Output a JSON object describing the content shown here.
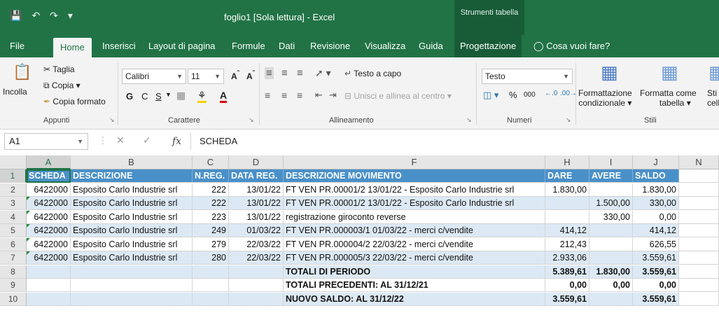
{
  "titlebar": {
    "title": "foglio1  [Sola lettura]  -  Excel",
    "tool_context": "Strumenti tabella"
  },
  "tabs": [
    "File",
    "Home",
    "Inserisci",
    "Layout di pagina",
    "Formule",
    "Dati",
    "Revisione",
    "Visualizza",
    "Guida",
    "Progettazione"
  ],
  "tell_me": "Cosa vuoi fare?",
  "ribbon": {
    "appunti": {
      "incolla": "Incolla",
      "taglia": "Taglia",
      "copia": "Copia",
      "copia_formato": "Copia formato",
      "label": "Appunti"
    },
    "carattere": {
      "font": "Calibri",
      "size": "11",
      "bold": "G",
      "italic": "C",
      "underline": "S",
      "label": "Carattere"
    },
    "allineamento": {
      "testo_a_capo": "Testo a capo",
      "unisci": "Unisci e allinea al centro",
      "label": "Allineamento"
    },
    "numeri": {
      "format": "Testo",
      "percent": "%",
      "thousands": "000",
      "label": "Numeri"
    },
    "stili": {
      "formattazione": "Formattazione",
      "condizionale": "condizionale",
      "formatta_come": "Formatta come",
      "tabella": "tabella",
      "stili_cella": "Sti",
      "cella": "cell",
      "label": "Stili"
    }
  },
  "formula_bar": {
    "name_box": "A1",
    "value": "SCHEDA"
  },
  "columns": [
    "A",
    "B",
    "C",
    "D",
    "E",
    "F",
    "G",
    "H",
    "I",
    "J",
    "N"
  ],
  "rows": [
    "1",
    "2",
    "3",
    "4",
    "5",
    "6",
    "7",
    "8",
    "9",
    "10"
  ],
  "table": {
    "headers": {
      "scheda": "SCHEDA",
      "descrizione": "DESCRIZIONE",
      "nreg": "N.REG.",
      "datareg": "DATA REG.",
      "movimento": "DESCRIZIONE MOVIMENTO",
      "dare": "DARE",
      "avere": "AVERE",
      "saldo": "SALDO"
    },
    "data_rows": [
      {
        "scheda": "6422000",
        "descrizione": "Esposito Carlo Industrie srl",
        "nreg": "222",
        "data": "13/01/22",
        "movimento": "FT VEN PR.00001/2 13/01/22 - Esposito Carlo Industrie srl",
        "dare": "1.830,00",
        "avere": "",
        "saldo": "1.830,00"
      },
      {
        "scheda": "6422000",
        "descrizione": "Esposito Carlo Industrie srl",
        "nreg": "222",
        "data": "13/01/22",
        "movimento": "FT VEN PR.00001/2 13/01/22 - Esposito Carlo Industrie srl",
        "dare": "",
        "avere": "1.500,00",
        "saldo": "330,00"
      },
      {
        "scheda": "6422000",
        "descrizione": "Esposito Carlo Industrie srl",
        "nreg": "223",
        "data": "13/01/22",
        "movimento": "registrazione giroconto reverse",
        "dare": "",
        "avere": "330,00",
        "saldo": "0,00"
      },
      {
        "scheda": "6422000",
        "descrizione": "Esposito Carlo Industrie srl",
        "nreg": "249",
        "data": "01/03/22",
        "movimento": "FT VEN PR.000003/1 01/03/22 - merci c/vendite",
        "dare": "414,12",
        "avere": "",
        "saldo": "414,12"
      },
      {
        "scheda": "6422000",
        "descrizione": "Esposito Carlo Industrie srl",
        "nreg": "279",
        "data": "22/03/22",
        "movimento": "FT VEN PR.000004/2 22/03/22 - merci c/vendite",
        "dare": "212,43",
        "avere": "",
        "saldo": "626,55"
      },
      {
        "scheda": "6422000",
        "descrizione": "Esposito Carlo Industrie srl",
        "nreg": "280",
        "data": "22/03/22",
        "movimento": "FT VEN PR.000005/3 22/03/22 - merci c/vendite",
        "dare": "2.933,06",
        "avere": "",
        "saldo": "3.559,61"
      }
    ],
    "totals": [
      {
        "label": "TOTALI DI PERIODO",
        "dare": "5.389,61",
        "avere": "1.830,00",
        "saldo": "3.559,61"
      },
      {
        "label": "TOTALI PRECEDENTI:  AL 31/12/21",
        "dare": "0,00",
        "avere": "0,00",
        "saldo": "0,00"
      },
      {
        "label": "NUOVO SALDO:  AL 31/12/22",
        "dare": "3.559,61",
        "avere": "",
        "saldo": "3.559,61"
      }
    ]
  }
}
